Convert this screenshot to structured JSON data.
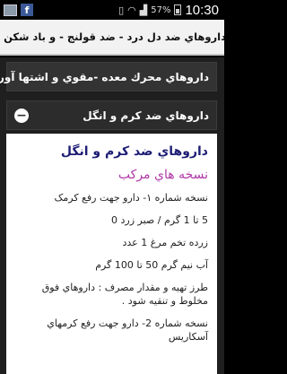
{
  "status_bar": {
    "battery": "57%",
    "time": "10:30",
    "fb_letter": "f"
  },
  "marquee": {
    "text": "داروهاي ضد دل درد - ضد قولنج - و باد شکن و ضد نفخ"
  },
  "accordion": [
    {
      "label": "داروهاي محرك معده -مقوي و اشتها آور",
      "toggle": "+"
    },
    {
      "label": "داروهاي ضد کرم و انگل",
      "toggle": "−"
    }
  ],
  "content": {
    "title": "داروهاي ضد کرم و انگل",
    "subtitle": "نسخه هاي مرکب",
    "lines": [
      "نسخه شماره ۱- دارو جهت رفع کرمک",
      "5 تا 1 گرم / صبر زرد 0",
      "زرده تخم مرغ 1 عدد",
      "آب نیم گرم 50 تا 100 گرم",
      "طرز تهیه و مقدار مصرف : داروهاي فوق مخلوط و تنقیه شود .",
      "نسخه شماره 2- دارو جهت رفع کرمهاي آسکاریس"
    ]
  }
}
